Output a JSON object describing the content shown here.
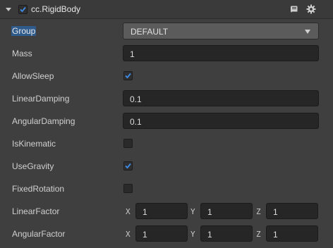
{
  "component": {
    "title": "cc.RigidBody",
    "enabled": true,
    "icons": {
      "doc": "book-icon",
      "settings": "gear-icon",
      "fold": "chevron-down-icon"
    }
  },
  "properties": {
    "group": {
      "label": "Group",
      "value": "DEFAULT"
    },
    "mass": {
      "label": "Mass",
      "value": "1"
    },
    "allow_sleep": {
      "label": "AllowSleep",
      "checked": true
    },
    "linear_damping": {
      "label": "LinearDamping",
      "value": "0.1"
    },
    "angular_damping": {
      "label": "AngularDamping",
      "value": "0.1"
    },
    "is_kinematic": {
      "label": "IsKinematic",
      "checked": false
    },
    "use_gravity": {
      "label": "UseGravity",
      "checked": true
    },
    "fixed_rotation": {
      "label": "FixedRotation",
      "checked": false
    },
    "linear_factor": {
      "label": "LinearFactor",
      "x_label": "X",
      "y_label": "Y",
      "z_label": "Z",
      "x": "1",
      "y": "1",
      "z": "1"
    },
    "angular_factor": {
      "label": "AngularFactor",
      "x_label": "X",
      "y_label": "Y",
      "z_label": "Z",
      "x": "1",
      "y": "1",
      "z": "1"
    }
  },
  "colors": {
    "accent_check": "#3d8de8",
    "highlight": "#2f5a8c"
  }
}
